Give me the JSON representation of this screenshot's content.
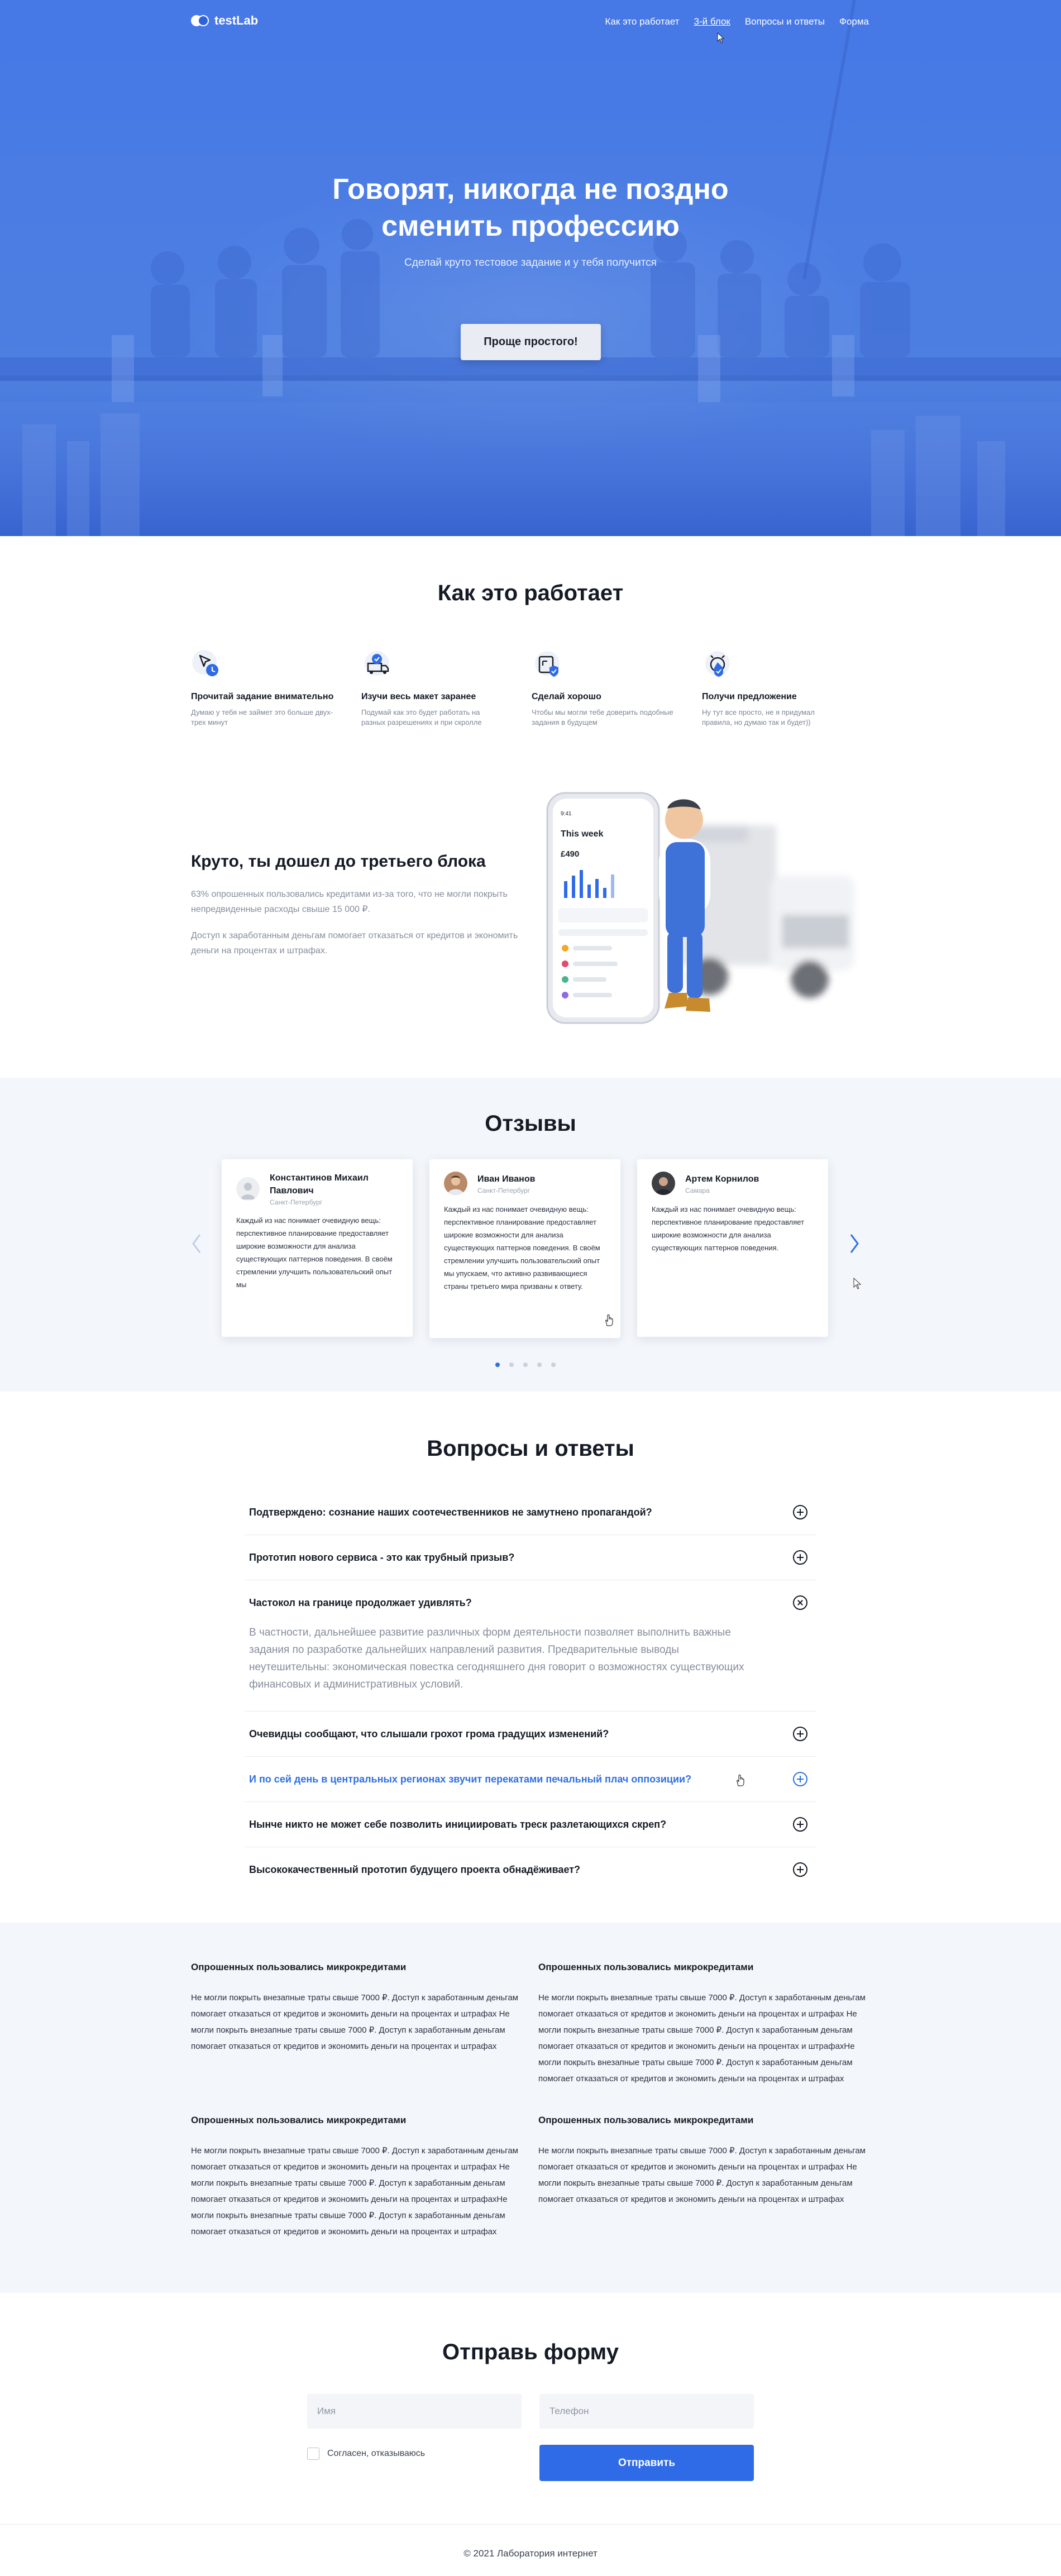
{
  "nav": {
    "logo": "testLab",
    "links": [
      "Как это работает",
      "3-й блок",
      "Вопросы и ответы",
      "Форма"
    ]
  },
  "hero": {
    "title_line1": "Говорят, никогда не поздно",
    "title_line2": "сменить профессию",
    "subtitle": "Сделай круто тестовое задание и у тебя получится",
    "button": "Проще простого!"
  },
  "how": {
    "title": "Как это работает",
    "steps": [
      {
        "title": "Прочитай задание внимательно",
        "text": "Думаю у тебя не займет это больше двух-трех минут",
        "icon": "cursor-clock-icon"
      },
      {
        "title": "Изучи весь макет заранее",
        "text": "Подумай как это будет работать на разных разрешениях и при скролле",
        "icon": "truck-check-icon"
      },
      {
        "title": "Сделай хорошо",
        "text": "Чтобы мы могли тебе доверить подобные задания в будущем",
        "icon": "resize-shield-icon"
      },
      {
        "title": "Получи предложение",
        "text": "Ну тут все просто, не я придумал правила, но думаю так и будет))",
        "icon": "alarm-shield-icon"
      }
    ]
  },
  "third": {
    "title": "Круто, ты дошел до третьего блока",
    "p1": "63% опрошенных пользовались кредитами из-за того, что не могли покрыть непредвиденные расходы свыше 15 000 ₽.",
    "p2": "Доступ к заработанным деньгам помогает отказаться от кредитов и экономить деньги на процентах и штрафах.",
    "phone": {
      "time": "9:41",
      "header": "This week",
      "amount": "£490"
    }
  },
  "reviews": {
    "title": "Отзывы",
    "cards": [
      {
        "name": "Константинов Михаил Павлович",
        "city": "Санкт-Петербург",
        "text": "Каждый из нас понимает очевидную вещь: перспективное планирование предоставляет широкие возможности для анализа существующих паттернов поведения. В своём стремлении улучшить пользовательский опыт мы"
      },
      {
        "name": "Иван Иванов",
        "city": "Санкт-Петербург",
        "text": "Каждый из нас понимает очевидную вещь: перспективное планирование предоставляет широкие возможности для анализа существующих паттернов поведения. В своём стремлении улучшить пользовательский опыт мы упускаем, что активно развивающиеся страны третьего мира призваны к ответу."
      },
      {
        "name": "Артем Корнилов",
        "city": "Самара",
        "text": "Каждый из нас понимает очевидную вещь: перспективное планирование предоставляет широкие возможности для анализа существующих паттернов поведения."
      }
    ],
    "arrow_prev": "‹",
    "arrow_next": "›"
  },
  "faq": {
    "title": "Вопросы и ответы",
    "items": [
      {
        "q": "Подтверждено: сознание наших соотечественников не замутнено пропагандой?"
      },
      {
        "q": "Прототип нового сервиса - это как трубный призыв?"
      },
      {
        "q": "Частокол на границе продолжает удивлять?",
        "a": "В частности, дальнейшее развитие различных форм деятельности позволяет выполнить важные задания по разработке дальнейших направлений развития. Предварительные выводы неутешительны: экономическая повестка сегодняшнего дня говорит о возможностях существующих финансовых и административных условий."
      },
      {
        "q": "Очевидцы сообщают, что слышали грохот грома градущих изменений?"
      },
      {
        "q": "И по сей день в центральных регионах звучит перекатами печальный плач оппозиции?"
      },
      {
        "q": "Нынче никто не может себе позволить инициировать треск разлетающихся скреп?"
      },
      {
        "q": "Высококачественный прототип будущего проекта обнадёживает?"
      }
    ]
  },
  "info": {
    "blocks": [
      {
        "title": "Опрошенных пользовались микрокредитами",
        "text": "Не могли покрыть внезапные траты свыше 7000 ₽. Доступ к заработанным деньгам помогает отказаться от кредитов и экономить деньги на процентах и штрафах Не могли покрыть внезапные траты свыше 7000 ₽. Доступ к заработанным деньгам помогает отказаться от кредитов и экономить деньги на процентах и штрафах"
      },
      {
        "title": "Опрошенных пользовались микрокредитами",
        "text": "Не могли покрыть внезапные траты свыше 7000 ₽. Доступ к заработанным деньгам помогает отказаться от кредитов и экономить деньги на процентах и штрафах Не могли покрыть внезапные траты свыше 7000 ₽. Доступ к заработанным деньгам помогает отказаться от кредитов и экономить деньги на процентах и штрафахНе могли покрыть внезапные траты свыше 7000 ₽. Доступ к заработанным деньгам помогает отказаться от кредитов и экономить деньги на процентах и штрафах"
      },
      {
        "title": "Опрошенных пользовались микрокредитами",
        "text": "Не могли покрыть внезапные траты свыше 7000 ₽. Доступ к заработанным деньгам помогает отказаться от кредитов и экономить деньги на процентах и штрафах Не могли покрыть внезапные траты свыше 7000 ₽. Доступ к заработанным деньгам помогает отказаться от кредитов и экономить деньги на процентах и штрафахНе могли покрыть внезапные траты свыше 7000 ₽. Доступ к заработанным деньгам помогает отказаться от кредитов и экономить деньги на процентах и штрафах"
      },
      {
        "title": "Опрошенных пользовались микрокредитами",
        "text": "Не могли покрыть внезапные траты свыше 7000 ₽. Доступ к заработанным деньгам помогает отказаться от кредитов и экономить деньги на процентах и штрафах Не могли покрыть внезапные траты свыше 7000 ₽. Доступ к заработанным деньгам помогает отказаться от кредитов и экономить деньги на процентах и штрафах"
      }
    ]
  },
  "form": {
    "title": "Отправь форму",
    "name_placeholder": "Имя",
    "phone_placeholder": "Телефон",
    "agree_label": "Согласен, отказываюсь",
    "submit": "Отправить"
  },
  "footer": {
    "copyright": "© 2021 Лаборатория интернет"
  },
  "colors": {
    "primary": "#2f6be6",
    "hero": "#4678e6",
    "section_bg": "#f3f6fa"
  }
}
